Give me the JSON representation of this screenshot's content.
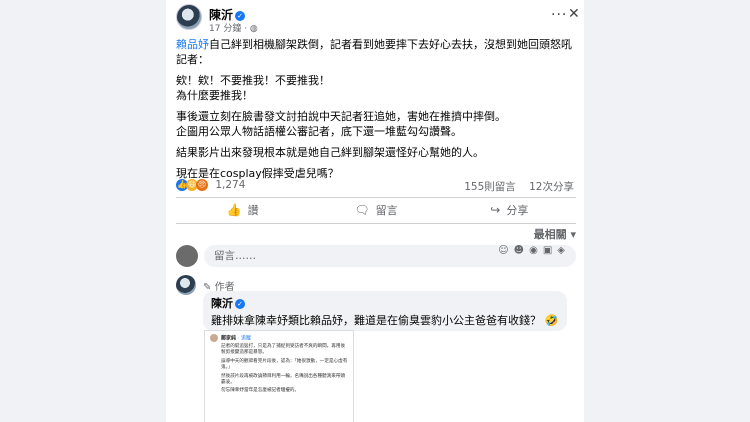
{
  "post": {
    "author": "陳沂",
    "time": "17 分鐘",
    "tag": "賴品妤",
    "paragraphs": [
      "自己絆到相機腳架跌倒，記者看到她要摔下去好心去扶，沒想到她回頭怒吼記者：",
      "欸！欸！不要推我！不要推我！\n為什麼要推我！",
      "事後還立刻在臉書發文討拍說中天記者狂追她，害她在推擠中摔倒。\n企圖用公眾人物話語權公審記者，底下還一堆藍勾勾讚聲。",
      "結果影片出來發現根本就是她自己絆到腳架還怪好心幫她的人。",
      "現在是在cosplay假摔受虐兒嗎？"
    ],
    "reactions_count": "1,274",
    "comments_count": "155則留言",
    "shares_count": "12次分享"
  },
  "actions": {
    "like": "讚",
    "comment": "留言",
    "share": "分享"
  },
  "sort_label": "最相關 ▾",
  "comment_input": {
    "placeholder": "留言……"
  },
  "top_comment": {
    "author_tag": "作者",
    "author": "陳沂",
    "text": "雞排妹拿陳幸妤類比賴品妤，難道是在偷臭雲豹小公主爸爸有收錢？"
  },
  "embedded_screenshot": {
    "author": "鄭家純",
    "tag": "· 追蹤",
    "lines": [
      "記者的窮追猛打，只是為了捕捉到受訪者不爽的瞬間，再用後製剪接變造那是暴怒。",
      "誤導中天的觀眾看完片段後，認為：「她很激動，一定是心虛有鬼。」",
      "然後該片段再被政論節目利用一輪，名嘴說出各種聽測來帶頭霸凌。",
      "勿忘陳幸妤當年是怎麼被記者騷擾的。"
    ]
  },
  "colors": {
    "accent": "#1877f2",
    "secondary_text": "#65676b",
    "comment_bg": "#f0f2f5"
  }
}
